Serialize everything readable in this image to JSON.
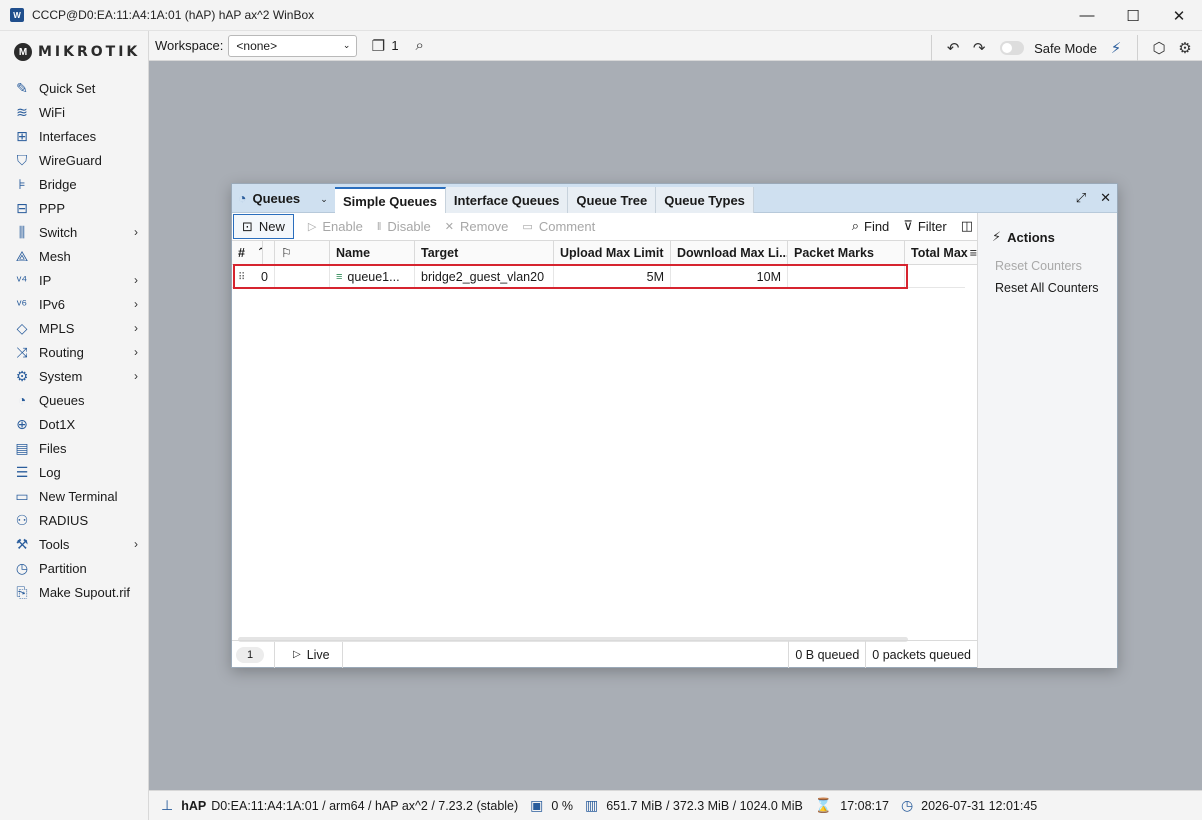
{
  "window": {
    "title": "CCCP@D0:EA:11:A4:1A:01 (hAP) hAP ax^2 WinBox",
    "app_icon_text": "W",
    "minimize": "—",
    "maximize": "☐",
    "close": "✕"
  },
  "brand": {
    "logo_mark": "M",
    "logo_text": "MIKROTIK"
  },
  "sidebar": {
    "items": [
      {
        "label": "Quick Set",
        "icon": "✎",
        "submenu": false
      },
      {
        "label": "WiFi",
        "icon": "≋",
        "submenu": false
      },
      {
        "label": "Interfaces",
        "icon": "⊞",
        "submenu": false
      },
      {
        "label": "WireGuard",
        "icon": "⛉",
        "submenu": false
      },
      {
        "label": "Bridge",
        "icon": "⊧",
        "submenu": false
      },
      {
        "label": "PPP",
        "icon": "⊟",
        "submenu": false
      },
      {
        "label": "Switch",
        "icon": "⫼",
        "submenu": true
      },
      {
        "label": "Mesh",
        "icon": "⟁",
        "submenu": false
      },
      {
        "label": "IP",
        "icon": "ᵛ⁴",
        "submenu": true
      },
      {
        "label": "IPv6",
        "icon": "ᵛ⁶",
        "submenu": true
      },
      {
        "label": "MPLS",
        "icon": "◇",
        "submenu": true
      },
      {
        "label": "Routing",
        "icon": "⤨",
        "submenu": true
      },
      {
        "label": "System",
        "icon": "⚙",
        "submenu": true
      },
      {
        "label": "Queues",
        "icon": "◔",
        "submenu": false
      },
      {
        "label": "Dot1X",
        "icon": "⊕",
        "submenu": false
      },
      {
        "label": "Files",
        "icon": "▤",
        "submenu": false
      },
      {
        "label": "Log",
        "icon": "☰",
        "submenu": false
      },
      {
        "label": "New Terminal",
        "icon": "▭",
        "submenu": false
      },
      {
        "label": "RADIUS",
        "icon": "⚇",
        "submenu": false
      },
      {
        "label": "Tools",
        "icon": "⚒",
        "submenu": true
      },
      {
        "label": "Partition",
        "icon": "◷",
        "submenu": false
      },
      {
        "label": "Make Supout.rif",
        "icon": "⎘",
        "submenu": false
      }
    ],
    "chevron": "›"
  },
  "toolbar": {
    "workspace_label": "Workspace:",
    "workspace_value": "<none>",
    "workspace_arrow": "⌄",
    "windows_count": "1",
    "undo_icon": "↶",
    "redo_icon": "↷",
    "safe_mode_label": "Safe Mode"
  },
  "queues": {
    "title": "Queues",
    "tabs": [
      "Simple Queues",
      "Interface Queues",
      "Queue Tree",
      "Queue Types"
    ],
    "active_tab": 0,
    "actions_bar": {
      "new": "New",
      "enable": "Enable",
      "disable": "Disable",
      "remove": "Remove",
      "comment": "Comment",
      "find": "Find",
      "filter": "Filter"
    },
    "columns": [
      "#",
      "",
      "Name",
      "Target",
      "Upload Max Limit",
      "Download Max Li...",
      "Packet Marks",
      "Total Max"
    ],
    "rows": [
      {
        "num": "0",
        "name": "queue1...",
        "target": "bridge2_guest_vlan20",
        "upload": "5M",
        "download": "10M",
        "marks": ""
      }
    ],
    "footer": {
      "page": "1",
      "live": "Live",
      "bytes_queued": "0 B  queued",
      "packets_queued": "0  packets queued"
    },
    "side_actions": {
      "title": "Actions",
      "reset_counters": "Reset Counters",
      "reset_all_counters": "Reset All Counters"
    }
  },
  "status": {
    "device": "hAP",
    "info": "D0:EA:11:A4:1A:01 / arm64 / hAP ax^2 / 7.23.2 (stable)",
    "cpu": "0 %",
    "memory": "651.7 MiB / 372.3 MiB / 1024.0 MiB",
    "uptime": "17:08:17",
    "datetime": "2026-07-31 12:01:45"
  },
  "colors": {
    "accent": "#2a6ebd",
    "highlight_box": "#d6242f",
    "window_header": "#cfe0f0"
  }
}
